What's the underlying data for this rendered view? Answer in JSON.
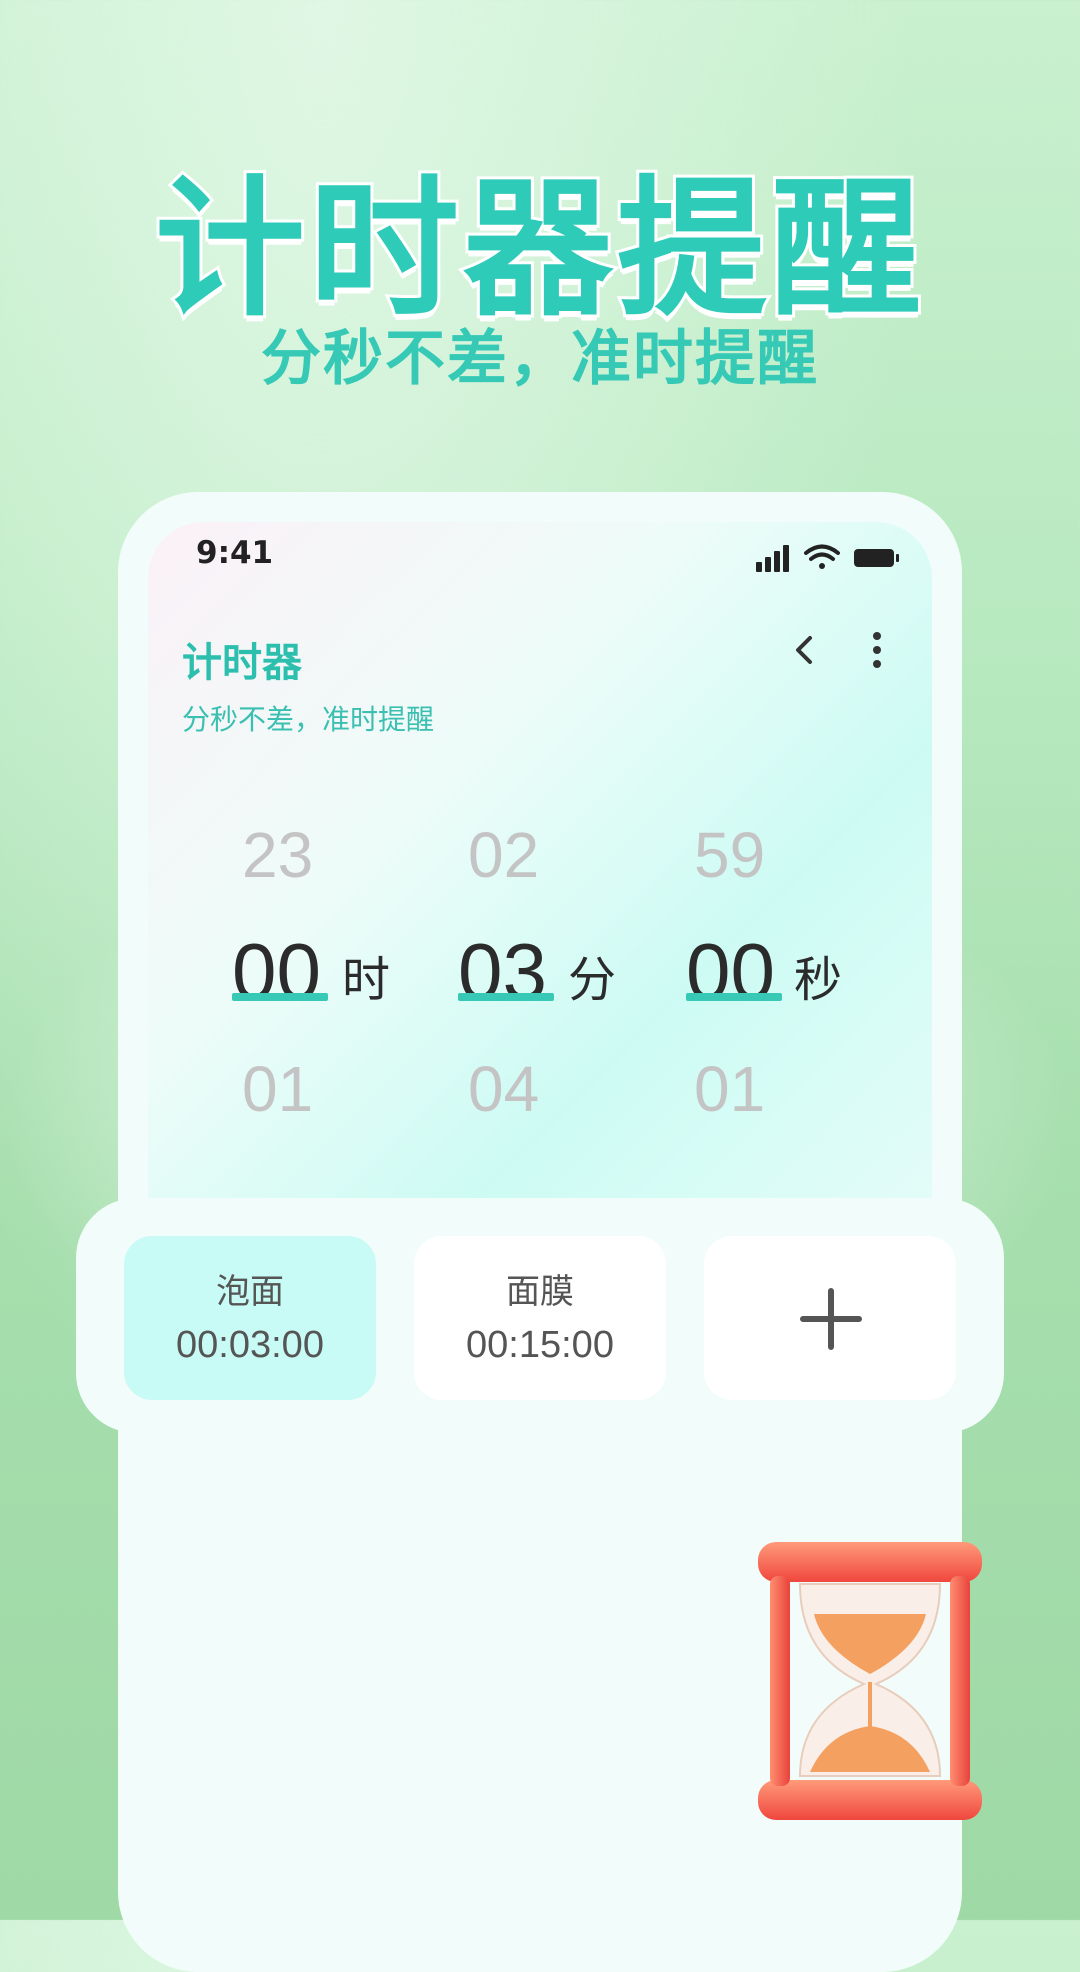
{
  "hero": {
    "title": "计时器提醒",
    "subtitle": "分秒不差，准时提醒"
  },
  "status": {
    "time": "9:41"
  },
  "app": {
    "title": "计时器",
    "subtitle": "分秒不差，准时提醒"
  },
  "picker": {
    "hours": {
      "prev": "23",
      "selected": "00",
      "next": "01",
      "unit": "时"
    },
    "minutes": {
      "prev": "02",
      "selected": "03",
      "next": "04",
      "unit": "分"
    },
    "seconds": {
      "prev": "59",
      "selected": "00",
      "next": "01",
      "unit": "秒"
    }
  },
  "presets": [
    {
      "name": "泡面",
      "time": "00:03:00",
      "active": true
    },
    {
      "name": "面膜",
      "time": "00:15:00",
      "active": false
    }
  ],
  "colors": {
    "accent": "#2fcbb9",
    "active_preset": "#c8fbf5"
  },
  "icons": [
    "signal-icon",
    "wifi-icon",
    "battery-icon",
    "back-icon",
    "more-icon",
    "plus-icon",
    "hourglass-icon"
  ]
}
